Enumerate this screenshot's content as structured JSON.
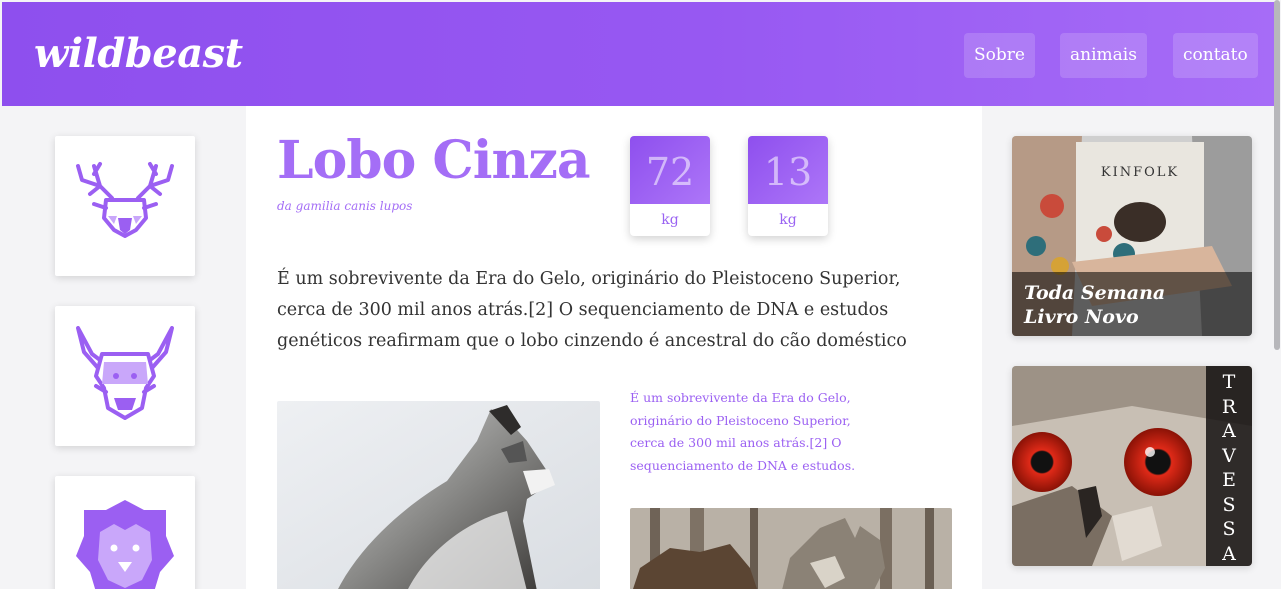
{
  "header": {
    "logo": "wildbeast",
    "nav": [
      "Sobre",
      "animais",
      "contato"
    ]
  },
  "sidebar": {
    "cards": [
      {
        "icon": "deer-icon"
      },
      {
        "icon": "bull-icon"
      },
      {
        "icon": "lion-icon"
      }
    ]
  },
  "main": {
    "title": "Lobo Cinza",
    "subtitle": "da gamilia canis lupos",
    "stats": [
      {
        "value": "72",
        "unit": "kg"
      },
      {
        "value": "13",
        "unit": "kg"
      }
    ],
    "paragraph": "É um sobrevivente da Era do Gelo, originário do Pleistoceno Superior, cerca de 300 mil anos atrás.[2] O sequenciamento de DNA e estudos genéticos reafirmam que o lobo cinzendo é ancestral do cão doméstico",
    "side_note": "É um sobrevivente da Era do Gelo, originário do Pleistoceno Superior, cerca de 300 mil anos atrás.[2] O sequenciamento de DNA e estudos."
  },
  "promos": {
    "book": {
      "magazine_title": "KINFOLK",
      "caption_line1": "Toda Semana",
      "caption_line2": "Livro Novo"
    },
    "owl": {
      "vertical_text": [
        "T",
        "R",
        "A",
        "V",
        "E",
        "S",
        "S",
        "A"
      ]
    }
  },
  "colors": {
    "accent": "#9758f2",
    "accent_light": "#a46ef6",
    "background": "#f4f4f6"
  }
}
